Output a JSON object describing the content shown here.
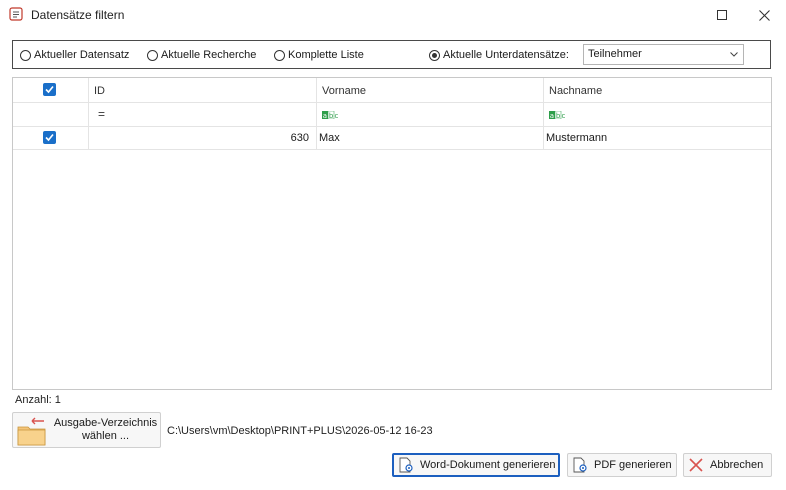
{
  "window": {
    "title": "Datensätze filtern"
  },
  "scope": {
    "options": [
      {
        "label": "Aktueller Datensatz",
        "checked": false
      },
      {
        "label": "Aktuelle Recherche",
        "checked": false
      },
      {
        "label": "Komplette Liste",
        "checked": false
      },
      {
        "label": "Aktuelle Unterdatensätze:",
        "checked": true
      }
    ],
    "subrecord_select": {
      "value": "Teilnehmer"
    }
  },
  "grid": {
    "columns": [
      "ID",
      "Vorname",
      "Nachname"
    ],
    "filter_row": {
      "id_operator": "=",
      "text_icon": "abc-text-filter-icon"
    },
    "rows": [
      {
        "checked": true,
        "id": "630",
        "vorname": "Max",
        "nachname": "Mustermann"
      }
    ]
  },
  "footer": {
    "count_label": "Anzahl: 1",
    "output_dir_button": "Ausgabe-Verzeichnis wählen ...",
    "output_path": "C:\\Users\\vm\\Desktop\\PRINT+PLUS\\2026-05-12 16-23"
  },
  "buttons": {
    "word": "Word-Dokument generieren",
    "pdf": "PDF generieren",
    "cancel": "Abbrechen"
  },
  "colors": {
    "accent": "#1a6fc9",
    "primary_border": "#1c5fbf",
    "cancel_x": "#d9534f",
    "folder": "#f4c57a"
  }
}
